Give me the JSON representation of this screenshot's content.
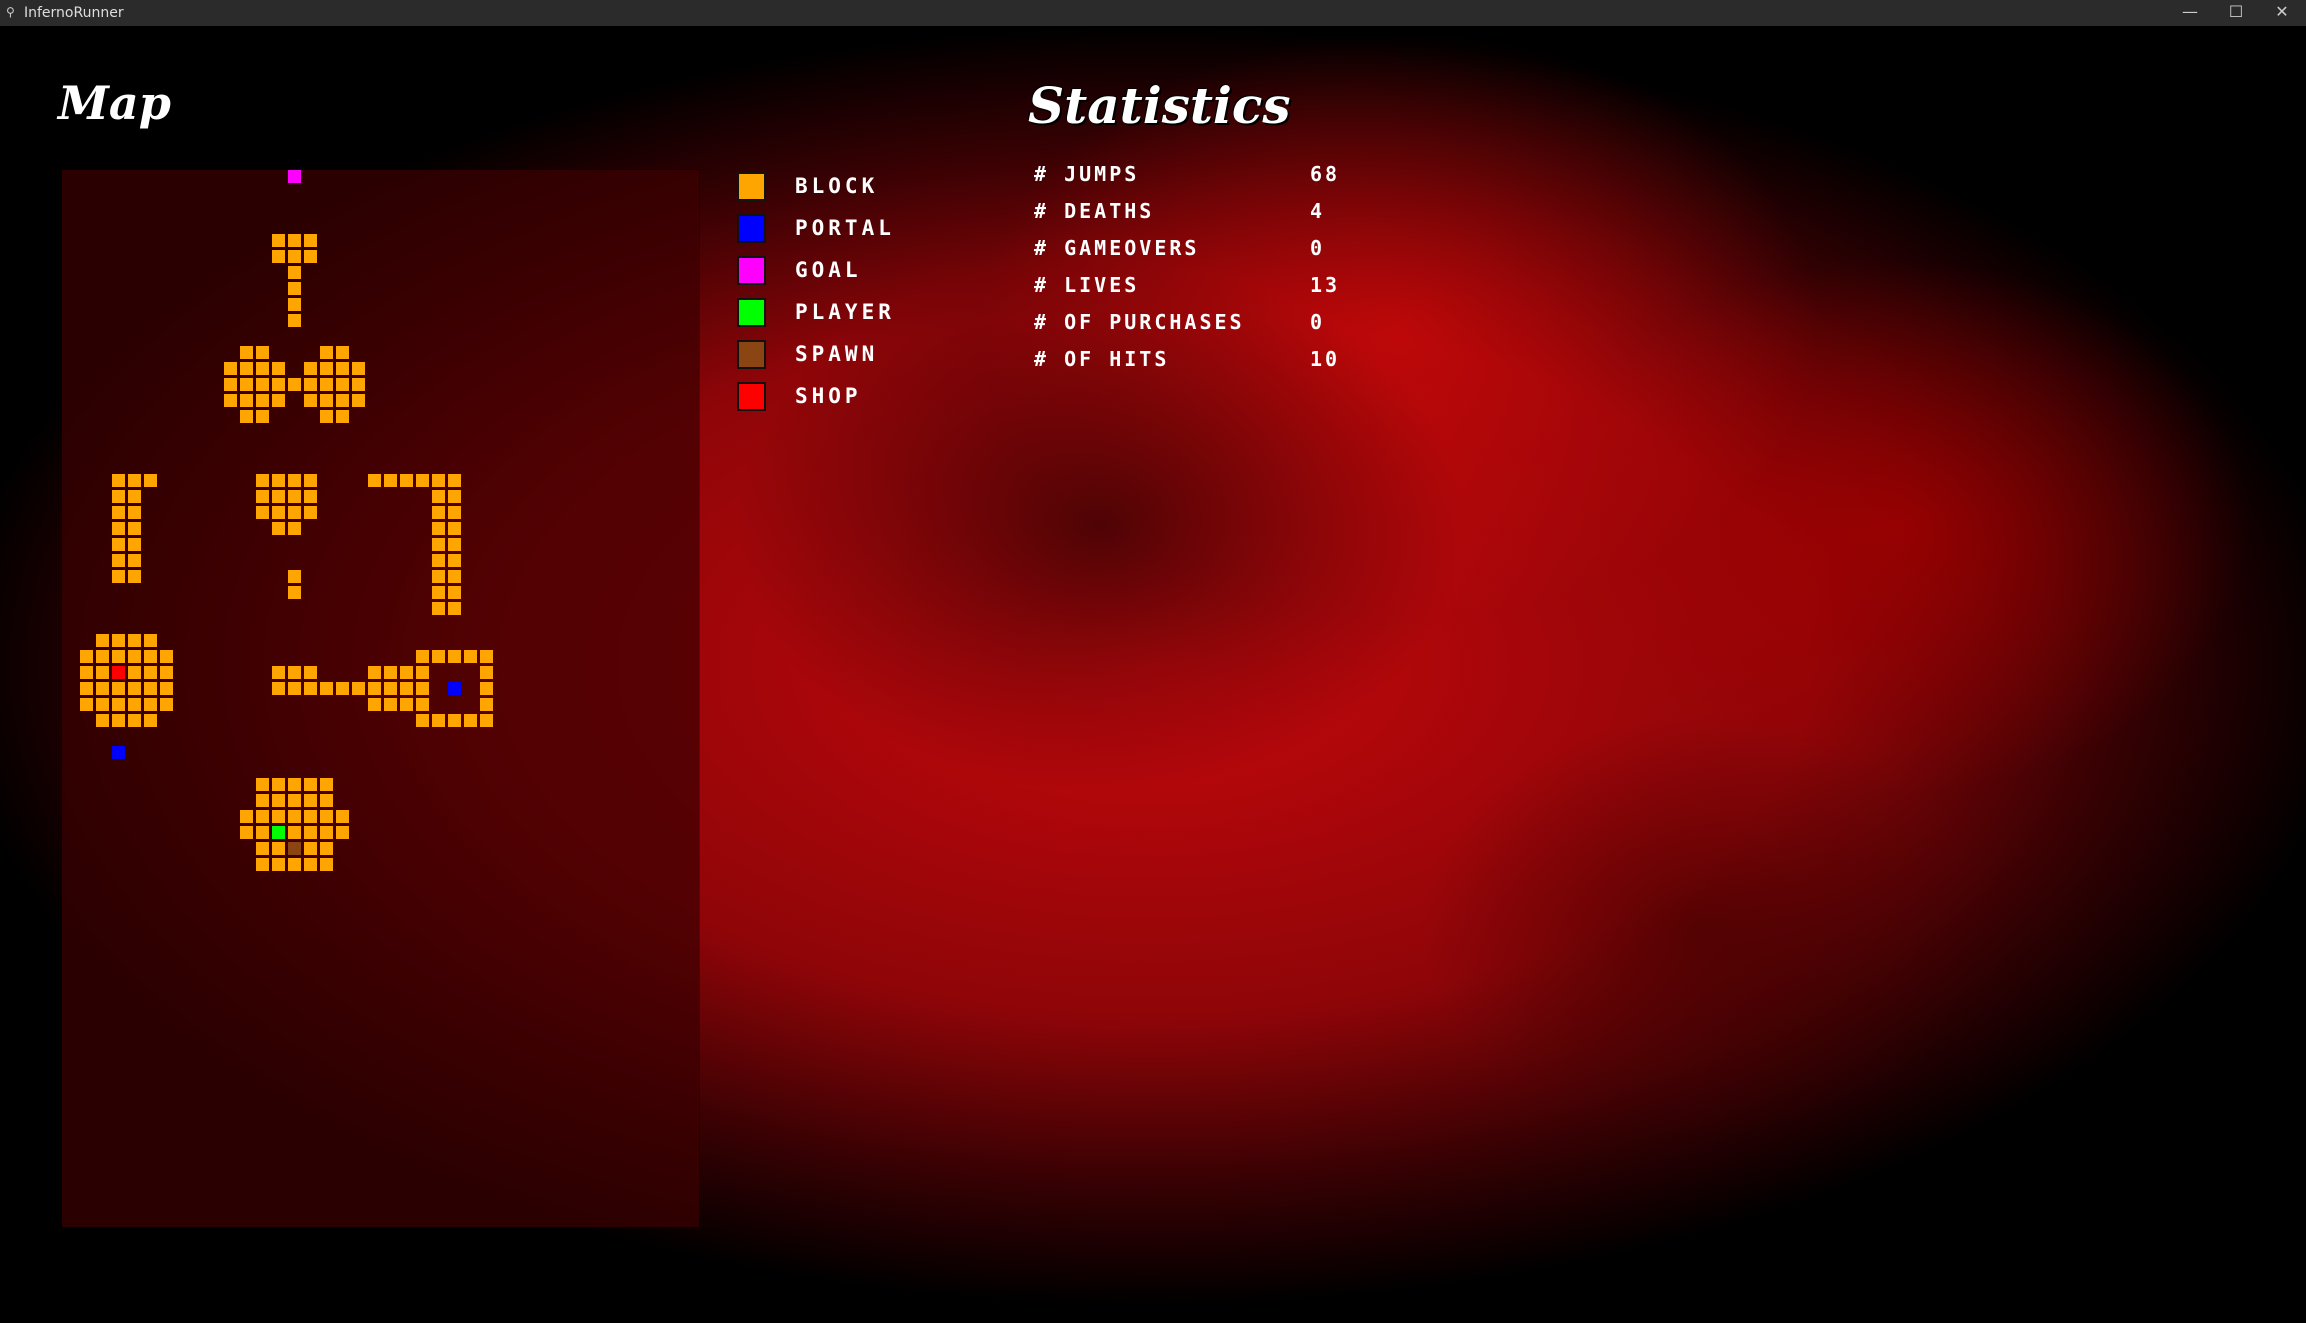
{
  "window": {
    "title": "InfernoRunner",
    "minimize": "—",
    "maximize": "☐",
    "close": "✕"
  },
  "headings": {
    "map": "Map",
    "statistics": "Statistics"
  },
  "legend": [
    {
      "label": "BLOCK",
      "color": "#ffa500"
    },
    {
      "label": "PORTAL",
      "color": "#0000ff"
    },
    {
      "label": "GOAL",
      "color": "#ff00ff"
    },
    {
      "label": "PLAYER",
      "color": "#00ff00"
    },
    {
      "label": "SPAWN",
      "color": "#8b4513"
    },
    {
      "label": "SHOP",
      "color": "#ff0000"
    }
  ],
  "statistics": [
    {
      "label": "# JUMPS",
      "value": "68"
    },
    {
      "label": "# DEATHS",
      "value": "4"
    },
    {
      "label": "# GAMEOVERS",
      "value": "0"
    },
    {
      "label": "# LIVES",
      "value": "13"
    },
    {
      "label": "# OF PURCHASES",
      "value": "0"
    },
    {
      "label": "# OF HITS",
      "value": "10"
    }
  ],
  "map_colors": {
    "block": "#ffa500",
    "portal": "#0000ff",
    "goal": "#ff00ff",
    "player": "#00ff00",
    "spawn": "#8b4513",
    "shop": "#ff0000"
  }
}
